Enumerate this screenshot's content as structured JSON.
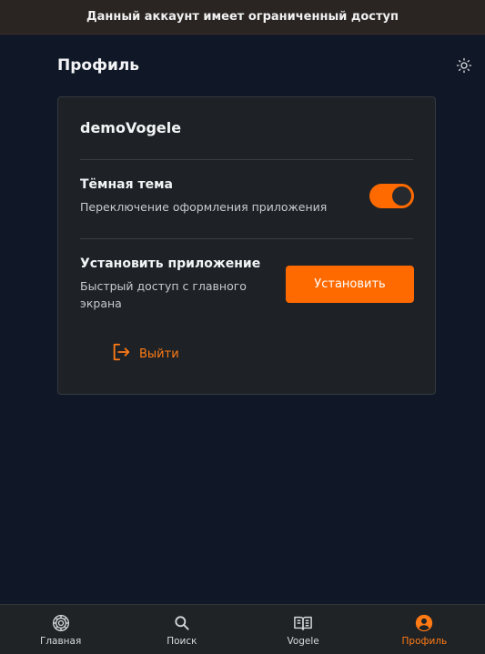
{
  "banner": {
    "text": "Данный аккаунт имеет ограниченный доступ"
  },
  "header": {
    "title": "Профиль",
    "theme_icon": "sun-icon"
  },
  "profile": {
    "username": "demoVogele",
    "dark_theme": {
      "title": "Тёмная тема",
      "subtitle": "Переключение оформления приложения",
      "enabled": true
    },
    "install": {
      "title": "Установить приложение",
      "subtitle_line1": "Быстрый доступ с главного",
      "subtitle_line2": "экрана",
      "button_label": "Установить"
    },
    "logout_label": "Выйти"
  },
  "nav": {
    "items": [
      {
        "label": "Главная",
        "icon": "home-wheel-icon",
        "active": false
      },
      {
        "label": "Поиск",
        "icon": "search-icon",
        "active": false
      },
      {
        "label": "Vogele",
        "icon": "book-icon",
        "active": false
      },
      {
        "label": "Профиль",
        "icon": "user-circle-icon",
        "active": true
      }
    ]
  },
  "colors": {
    "accent": "#ff6a00",
    "background": "#101726",
    "card": "#1e2226",
    "banner": "#2a2523"
  }
}
